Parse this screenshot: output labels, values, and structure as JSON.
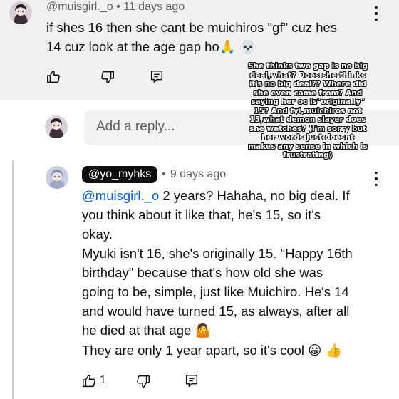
{
  "parent_comment": {
    "handle": "@muisgirl._o",
    "separator": "•",
    "time": "11 days ago",
    "text_line1": "if shes 16 then she cant be muichiros \"gf\" cuz hes",
    "text_line2": "14 cuz look at the age gap ho",
    "emoji": "🙏 💀"
  },
  "overlay_note": {
    "lines": [
      "She thinks two gap is no big",
      "deal,what? Does she thinks",
      "it's no big deal?? Where did",
      "she even came from? And",
      "saying her oc is\"originally\"",
      "15? And fyi,muichiros not",
      "15,what demon slayer does",
      "she watches? (I'm sorry but",
      "her words just doesnt",
      "makes any sense in which is",
      "frustrating)"
    ]
  },
  "reply_box": {
    "placeholder": "Add a reply..."
  },
  "reply_comment": {
    "handle": "@yo_myhks",
    "separator": "•",
    "time": "9 days ago",
    "mention": "@muisgirl._o",
    "lines": [
      " 2 years? Hahaha, no big deal. If",
      "you think about it like that, he's 15, so it's",
      "okay.",
      "Myuki isn't 16, she's originally 15. \"Happy 16th",
      "birthday\" because that's how old she was",
      "going to be, simple, just like Muichiro. He's 14",
      "and would have turned 15, as always, after all",
      "he died at that age",
      "They are only 1 year apart, so it's cool"
    ],
    "emoji_shrug": "🤷",
    "emoji_end": "😀 👍",
    "like_count": "1"
  },
  "icons": {
    "like": "thumbs-up-icon",
    "dislike": "thumbs-down-icon",
    "reply": "reply-comment-icon",
    "menu": "more-vertical-icon"
  },
  "colors": {
    "mention": "#065fd4",
    "handle_pill": "#0f0f0f",
    "top_band": "#f1f1f1",
    "reply_input": "#f2f2f2"
  }
}
